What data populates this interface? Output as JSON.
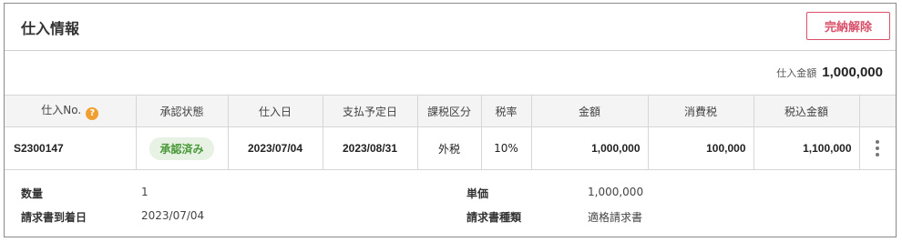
{
  "header": {
    "title": "仕入情報",
    "release_button": "完納解除"
  },
  "total": {
    "label": "仕入金額",
    "value": "1,000,000"
  },
  "table": {
    "columns": [
      "仕入No.",
      "承認状態",
      "仕入日",
      "支払予定日",
      "課税区分",
      "税率",
      "金額",
      "消費税",
      "税込金額"
    ],
    "help_icon": "?",
    "row": {
      "purchase_no": "S2300147",
      "status": "承認済み",
      "purchase_date": "2023/07/04",
      "payment_due": "2023/08/31",
      "tax_type": "外税",
      "tax_rate": "10%",
      "amount": "1,000,000",
      "tax": "100,000",
      "amount_with_tax": "1,100,000"
    }
  },
  "details": {
    "quantity_label": "数量",
    "quantity_value": "1",
    "invoice_arrival_label": "請求書到着日",
    "invoice_arrival_value": "2023/07/04",
    "unit_price_label": "単価",
    "unit_price_value": "1,000,000",
    "invoice_type_label": "請求書種類",
    "invoice_type_value": "適格請求書"
  },
  "colors": {
    "accent": "#d9506a",
    "status_green": "#4a9a3a",
    "help_orange": "#f0a030"
  }
}
